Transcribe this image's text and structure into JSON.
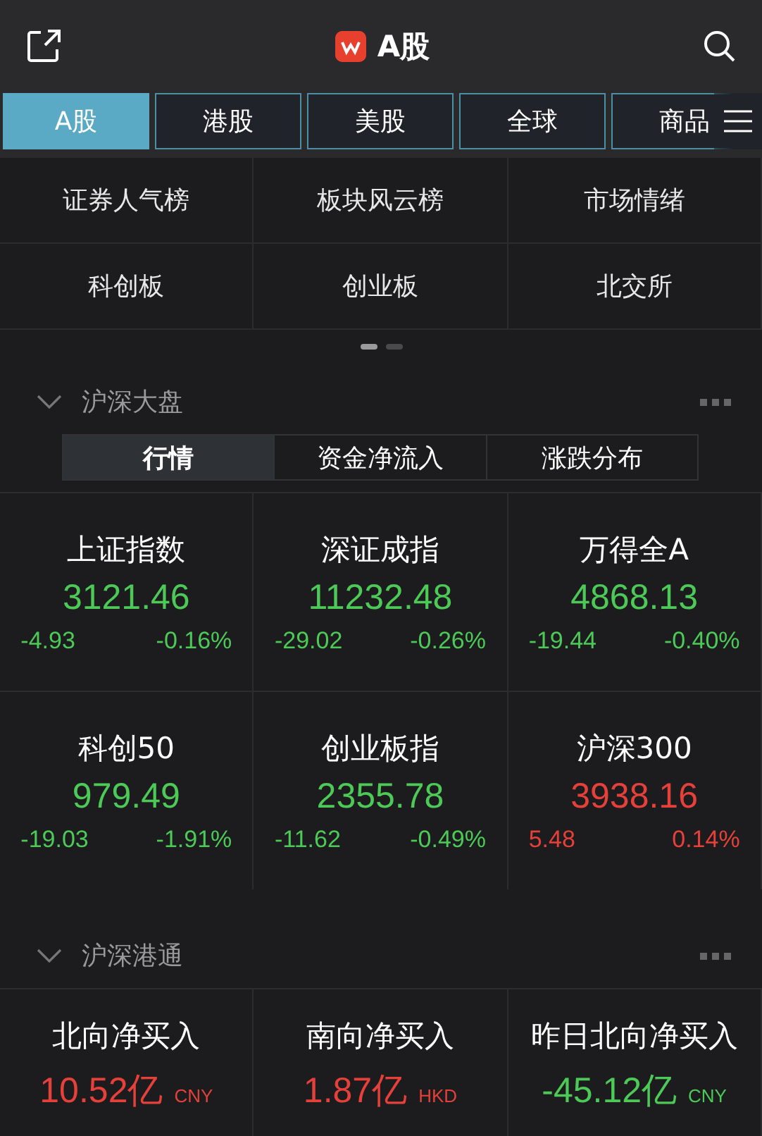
{
  "header": {
    "title": "A股"
  },
  "market_tabs": [
    {
      "label": "A股",
      "selected": true
    },
    {
      "label": "港股",
      "selected": false
    },
    {
      "label": "美股",
      "selected": false
    },
    {
      "label": "全球",
      "selected": false
    },
    {
      "label": "商品",
      "selected": false
    }
  ],
  "quick_links": [
    "证券人气榜",
    "板块风云榜",
    "市场情绪",
    "科创板",
    "创业板",
    "北交所"
  ],
  "pager": [
    {
      "selected": true
    },
    {
      "selected": false
    }
  ],
  "index_section": {
    "title": "沪深大盘",
    "segments": [
      {
        "label": "行情",
        "selected": true
      },
      {
        "label": "资金净流入",
        "selected": false
      },
      {
        "label": "涨跌分布",
        "selected": false
      }
    ],
    "indices": [
      {
        "name": "上证指数",
        "value": "3121.46",
        "change": "-4.93",
        "percent": "-0.16%",
        "color": "#4cc957"
      },
      {
        "name": "深证成指",
        "value": "11232.48",
        "change": "-29.02",
        "percent": "-0.26%",
        "color": "#4cc957"
      },
      {
        "name": "万得全A",
        "value": "4868.13",
        "change": "-19.44",
        "percent": "-0.40%",
        "color": "#4cc957"
      },
      {
        "name": "科创50",
        "value": "979.49",
        "change": "-19.03",
        "percent": "-1.91%",
        "color": "#4cc957"
      },
      {
        "name": "创业板指",
        "value": "2355.78",
        "change": "-11.62",
        "percent": "-0.49%",
        "color": "#4cc957"
      },
      {
        "name": "沪深300",
        "value": "3938.16",
        "change": "5.48",
        "percent": "0.14%",
        "color": "#e5403a"
      }
    ]
  },
  "connect_section": {
    "title": "沪深港通",
    "flows": [
      {
        "name": "北向净买入",
        "value": "10.52亿",
        "currency": "CNY",
        "color": "#e5403a"
      },
      {
        "name": "南向净买入",
        "value": "1.87亿",
        "currency": "HKD",
        "color": "#e5403a"
      },
      {
        "name": "昨日北向净买入",
        "value": "-45.12亿",
        "currency": "CNY",
        "color": "#4cc957"
      }
    ]
  }
}
